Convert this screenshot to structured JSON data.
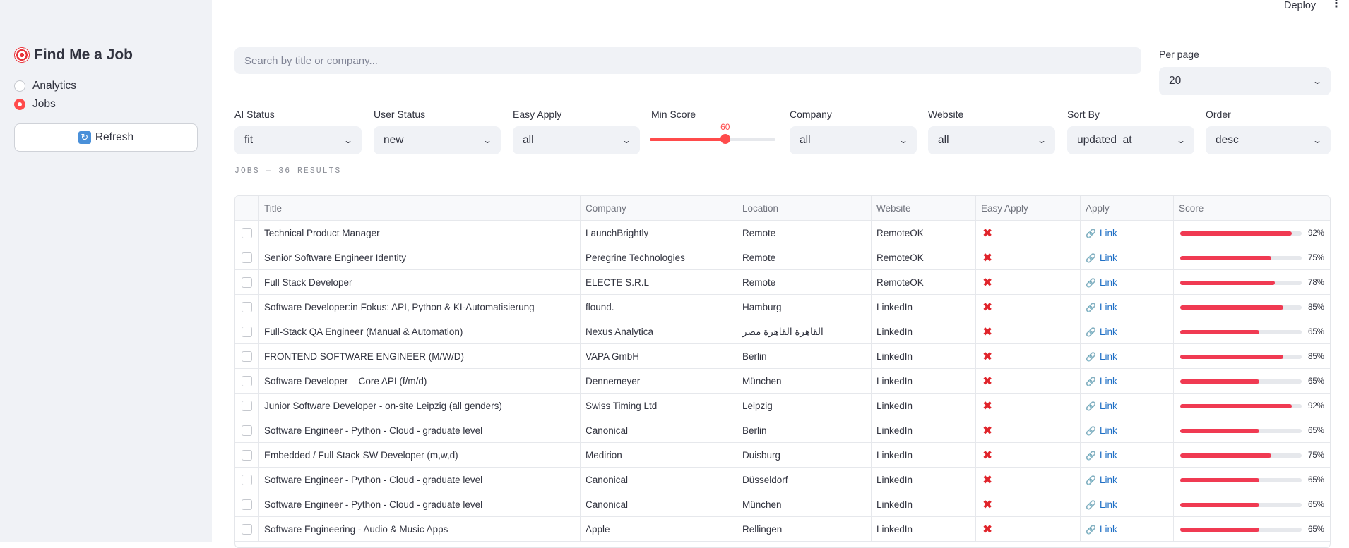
{
  "topbar": {
    "deploy_label": "Deploy",
    "menu_glyph": "⋮"
  },
  "sidebar": {
    "title": "Find Me a Job",
    "nav": [
      {
        "label": "Analytics",
        "selected": false
      },
      {
        "label": "Jobs",
        "selected": true
      }
    ],
    "refresh_label": "Refresh"
  },
  "search": {
    "placeholder": "Search by title or company..."
  },
  "per_page": {
    "label": "Per page",
    "value": "20"
  },
  "filters": {
    "ai_status": {
      "label": "AI Status",
      "value": "fit"
    },
    "user_status": {
      "label": "User Status",
      "value": "new"
    },
    "easy_apply": {
      "label": "Easy Apply",
      "value": "all"
    },
    "min_score": {
      "label": "Min Score",
      "value": "60",
      "fraction": 0.6
    },
    "company": {
      "label": "Company",
      "value": "all"
    },
    "website": {
      "label": "Website",
      "value": "all"
    },
    "sort_by": {
      "label": "Sort By",
      "value": "updated_at"
    },
    "order": {
      "label": "Order",
      "value": "desc"
    }
  },
  "section": {
    "heading": "JOBS — 36 RESULTS"
  },
  "table": {
    "columns": [
      "Title",
      "Company",
      "Location",
      "Website",
      "Easy Apply",
      "Apply",
      "Score"
    ],
    "link_label": "Link",
    "rows": [
      {
        "title": "Technical Product Manager",
        "company": "LaunchBrightly",
        "location": "Remote",
        "website": "RemoteOK",
        "score": 92,
        "score_label": "92%"
      },
      {
        "title": "Senior Software Engineer Identity",
        "company": "Peregrine Technologies",
        "location": "Remote",
        "website": "RemoteOK",
        "score": 75,
        "score_label": "75%"
      },
      {
        "title": "Full Stack Developer",
        "company": "ELECTE S.R.L",
        "location": "Remote",
        "website": "RemoteOK",
        "score": 78,
        "score_label": "78%"
      },
      {
        "title": "Software Developer:in Fokus: API, Python & KI-Automatisierung",
        "company": "flound.",
        "location": "Hamburg",
        "website": "LinkedIn",
        "score": 85,
        "score_label": "85%"
      },
      {
        "title": "Full-Stack QA Engineer (Manual & Automation)",
        "company": "Nexus Analytica",
        "location": "القاهرة القاهرة مصر",
        "website": "LinkedIn",
        "score": 65,
        "score_label": "65%",
        "rtl": true
      },
      {
        "title": "FRONTEND SOFTWARE ENGINEER (M/W/D)",
        "company": "VAPA GmbH",
        "location": "Berlin",
        "website": "LinkedIn",
        "score": 85,
        "score_label": "85%"
      },
      {
        "title": "Software Developer – Core API (f/m/d)",
        "company": "Dennemeyer",
        "location": "München",
        "website": "LinkedIn",
        "score": 65,
        "score_label": "65%"
      },
      {
        "title": "Junior Software Developer - on-site Leipzig (all genders)",
        "company": "Swiss Timing Ltd",
        "location": "Leipzig",
        "website": "LinkedIn",
        "score": 92,
        "score_label": "92%"
      },
      {
        "title": "Software Engineer - Python - Cloud - graduate level",
        "company": "Canonical",
        "location": "Berlin",
        "website": "LinkedIn",
        "score": 65,
        "score_label": "65%"
      },
      {
        "title": "Embedded / Full Stack SW Developer (m,w,d)",
        "company": "Medirion",
        "location": "Duisburg",
        "website": "LinkedIn",
        "score": 75,
        "score_label": "75%"
      },
      {
        "title": "Software Engineer - Python - Cloud - graduate level",
        "company": "Canonical",
        "location": "Düsseldorf",
        "website": "LinkedIn",
        "score": 65,
        "score_label": "65%"
      },
      {
        "title": "Software Engineer - Python - Cloud - graduate level",
        "company": "Canonical",
        "location": "München",
        "website": "LinkedIn",
        "score": 65,
        "score_label": "65%"
      },
      {
        "title": "Software Engineering - Audio & Music Apps",
        "company": "Apple",
        "location": "Rellingen",
        "website": "LinkedIn",
        "score": 65,
        "score_label": "65%"
      }
    ]
  },
  "icons": {
    "title_icon": "target-icon",
    "refresh_icon": "refresh-icon",
    "easy_apply_no": "x-icon",
    "apply_link": "link-icon",
    "select_caret": "chevron-down-icon"
  },
  "colors": {
    "accent": "#ff4b4b",
    "score_bar": "#f03a52",
    "link": "#1f6fc5",
    "no_mark": "#e0242b",
    "sidebar_bg": "#f0f2f6"
  }
}
